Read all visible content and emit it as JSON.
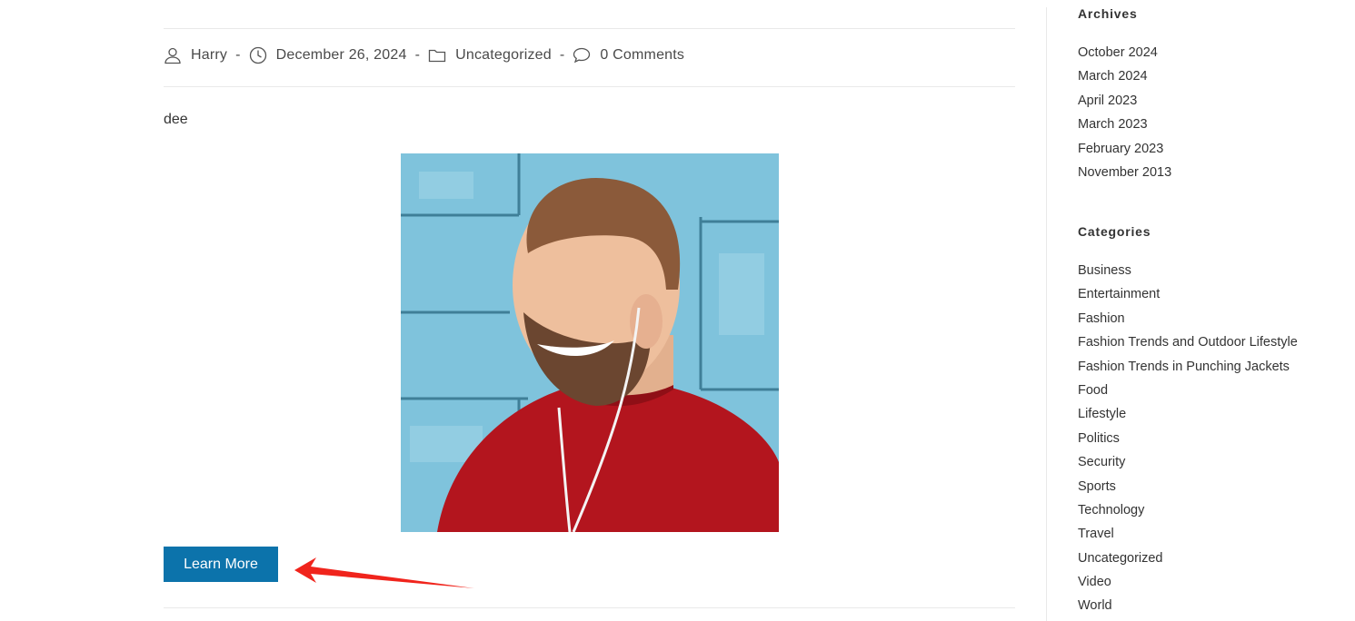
{
  "post_meta": {
    "author": "Harry",
    "date": "December 26, 2024",
    "category": "Uncategorized",
    "comments": "0 Comments",
    "separator": "-",
    "icons": [
      "user-icon",
      "clock-icon",
      "folder-icon",
      "comment-icon"
    ]
  },
  "post": {
    "excerpt": "dee",
    "button_label": "Learn More"
  },
  "sidebar": {
    "archives_title": "Archives",
    "archives": [
      "October 2024",
      "March 2024",
      "April 2023",
      "March 2023",
      "February 2023",
      "November 2013"
    ],
    "categories_title": "Categories",
    "categories": [
      "Business",
      "Entertainment",
      "Fashion",
      "Fashion Trends and Outdoor Lifestyle",
      "Fashion Trends in Punching Jackets",
      "Food",
      "Lifestyle",
      "Politics",
      "Security",
      "Sports",
      "Technology",
      "Travel",
      "Uncategorized",
      "Video",
      "World"
    ]
  },
  "colors": {
    "button": "#0c73ab",
    "arrow": "#f0241c",
    "wall": "#7fc3dc",
    "sweater": "#b3151e"
  }
}
